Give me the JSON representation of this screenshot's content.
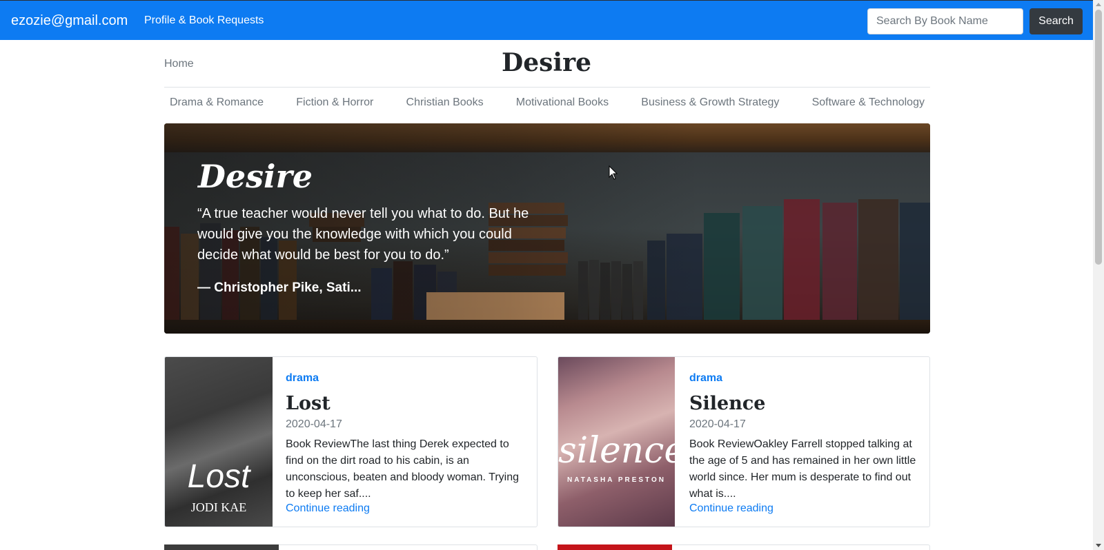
{
  "topbar": {
    "user_email": "ezozie@gmail.com",
    "profile_link": "Profile & Book Requests",
    "search_placeholder": "Search By Book Name",
    "search_button": "Search"
  },
  "header": {
    "home_link": "Home",
    "site_title": "Desire"
  },
  "categories": [
    "Drama & Romance",
    "Fiction & Horror",
    "Christian Books",
    "Motivational Books",
    "Business & Growth Strategy",
    "Software & Technology"
  ],
  "hero": {
    "title": "Desire",
    "quote": "“A true teacher would never tell you what to do. But he would give you the knowledge with which you could decide what would be best for you to do.”",
    "author": "— Christopher Pike, Sati..."
  },
  "posts": [
    {
      "category": "drama",
      "title": "Lost",
      "date": "2020-04-17",
      "excerpt": "Book ReviewThe last thing Derek expected to find on the dirt road to his cabin, is an unconscious, beaten and bloody woman. Trying to keep her saf....",
      "link": "Continue reading",
      "cover_title": "Lost",
      "cover_author": "JODI KAE"
    },
    {
      "category": "drama",
      "title": "Silence",
      "date": "2020-04-17",
      "excerpt": "Book ReviewOakley Farrell stopped talking at the age of 5 and has remained in her own little world since. Her mum is desperate to find out what is....",
      "link": "Continue reading",
      "cover_title": "silence",
      "cover_author": "NATASHA PRESTON"
    }
  ],
  "colors": {
    "navbar": "#0d7bf2",
    "dark_button": "#343a40",
    "link": "#0d7bf2",
    "muted": "#6c757d"
  },
  "icons": {
    "cursor": "mouse-pointer-icon"
  }
}
